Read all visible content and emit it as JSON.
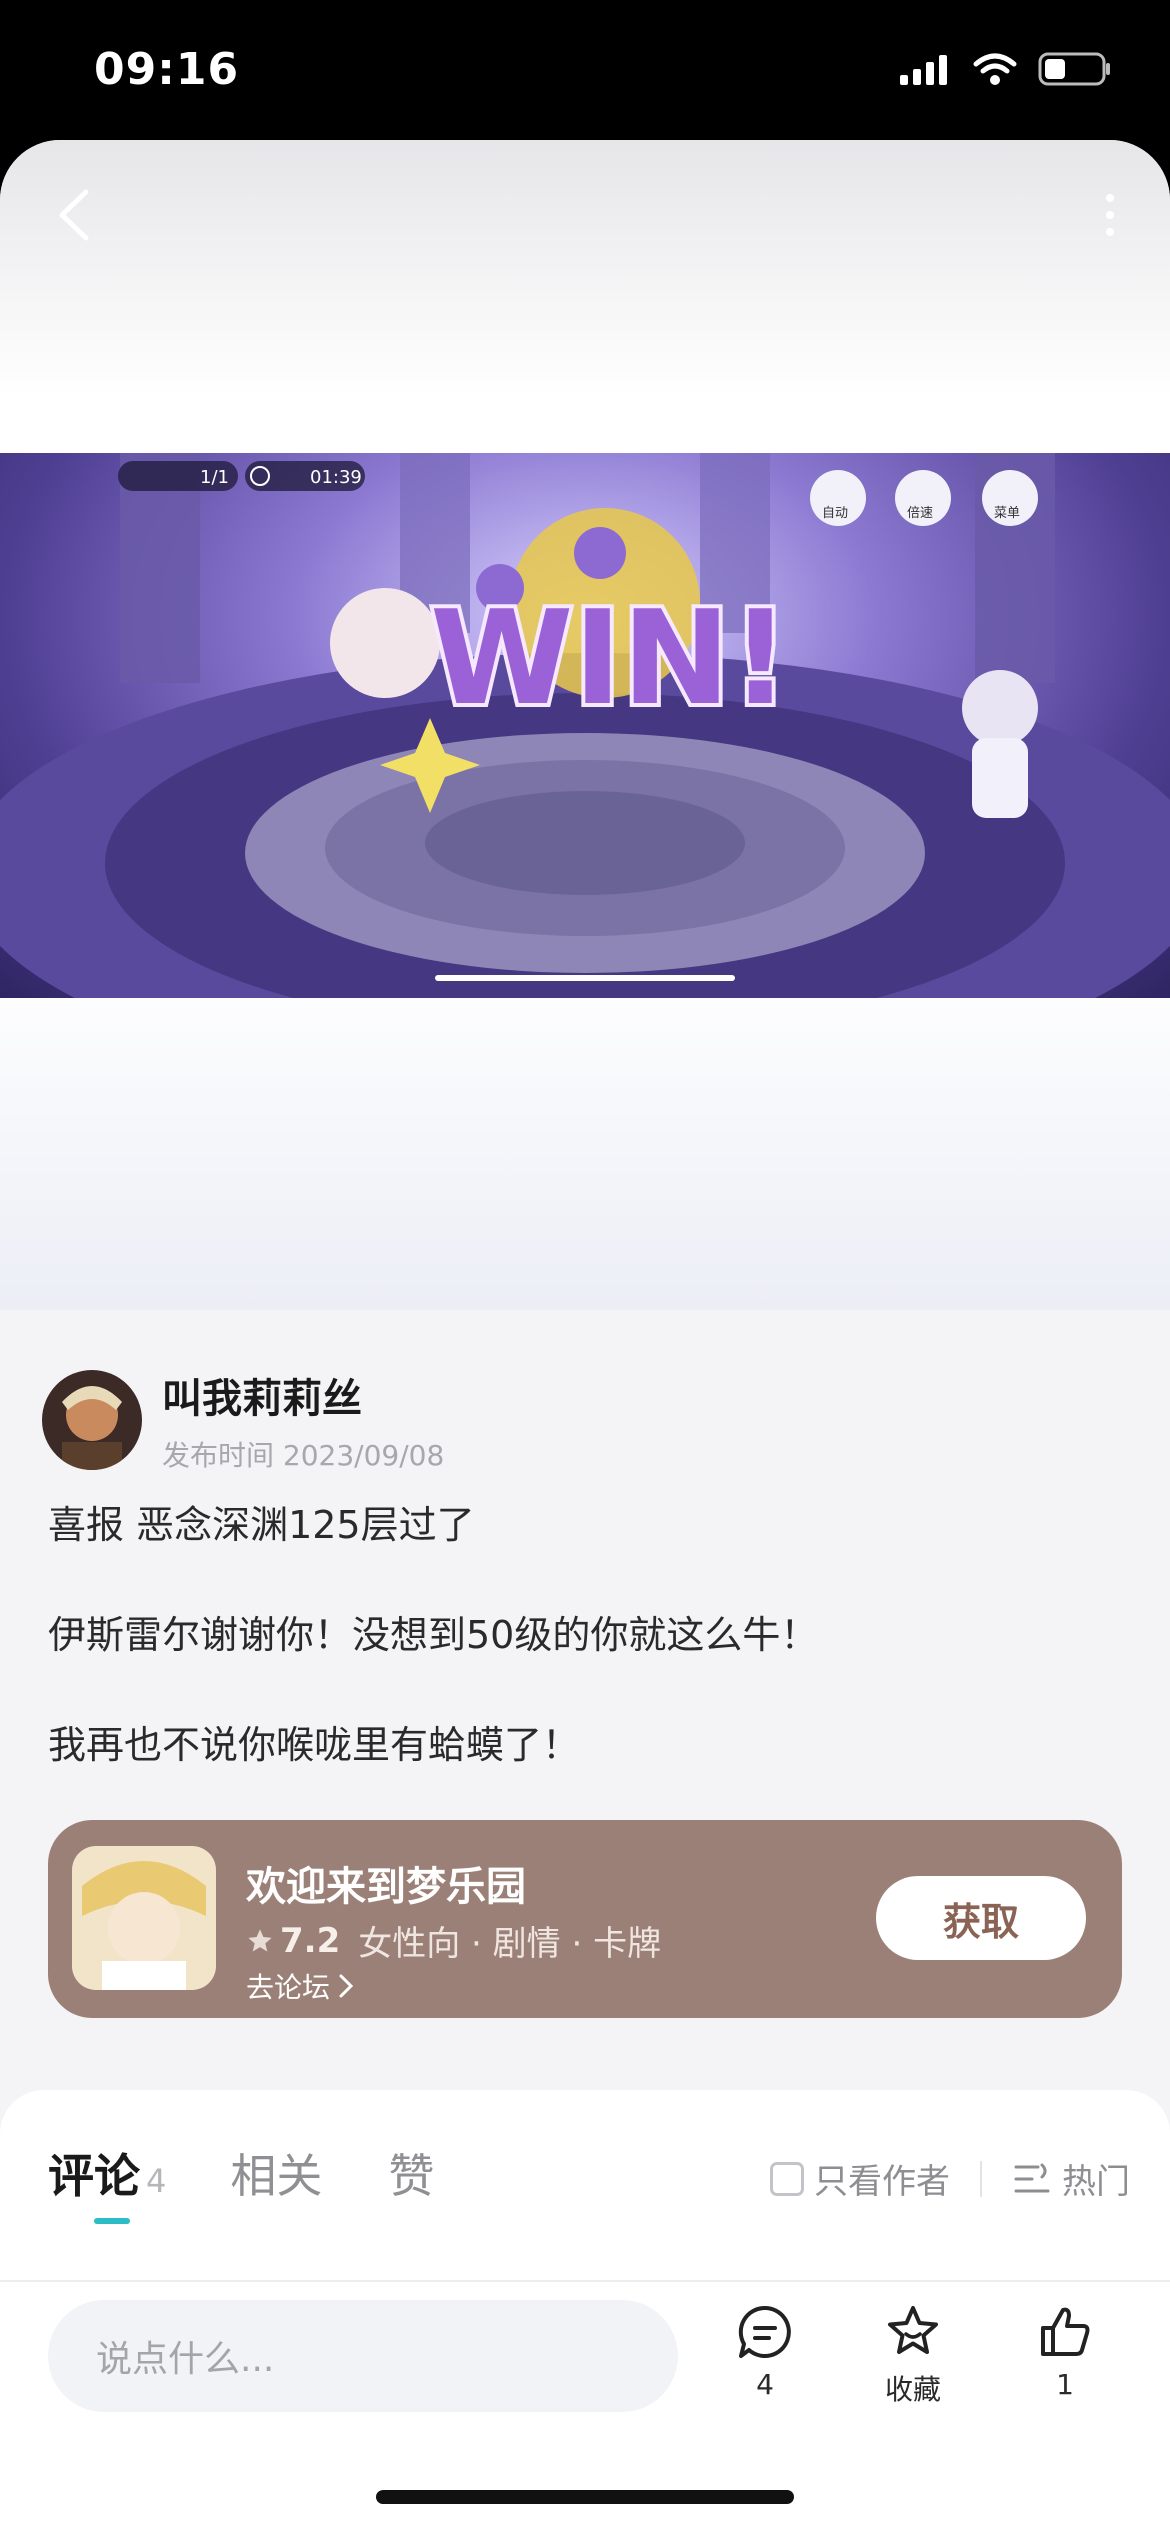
{
  "status_bar": {
    "time": "09:16"
  },
  "post": {
    "author": "叫我莉莉丝",
    "publish_time": "发布时间 2023/09/08",
    "lines": [
      "喜报 恶念深渊125层过了",
      "伊斯雷尔谢谢你！没想到50级的你就这么牛！",
      "我再也不说你喉咙里有蛤蟆了！"
    ]
  },
  "game_screenshot": {
    "battle_count": "1/1",
    "timer": "01:39",
    "buttons": [
      "自动",
      "倍速",
      "菜单"
    ],
    "banner": "WIN!"
  },
  "game_card": {
    "title": "欢迎来到梦乐园",
    "rating": "7.2",
    "tags": "女性向 · 剧情 · 卡牌",
    "forum_link": "去论坛",
    "get_label": "获取"
  },
  "tabs": [
    {
      "label": "评论",
      "count": "4"
    },
    {
      "label": "相关"
    },
    {
      "label": "赞"
    }
  ],
  "filters": {
    "author_only": "只看作者",
    "sort": "热门"
  },
  "bottom_bar": {
    "input_placeholder": "说点什么...",
    "comment_count": "4",
    "favorite_label": "收藏",
    "like_count": "1"
  },
  "colors": {
    "card": "#9b8077",
    "accent": "#2bbcc6",
    "get_text": "#8a6355"
  }
}
